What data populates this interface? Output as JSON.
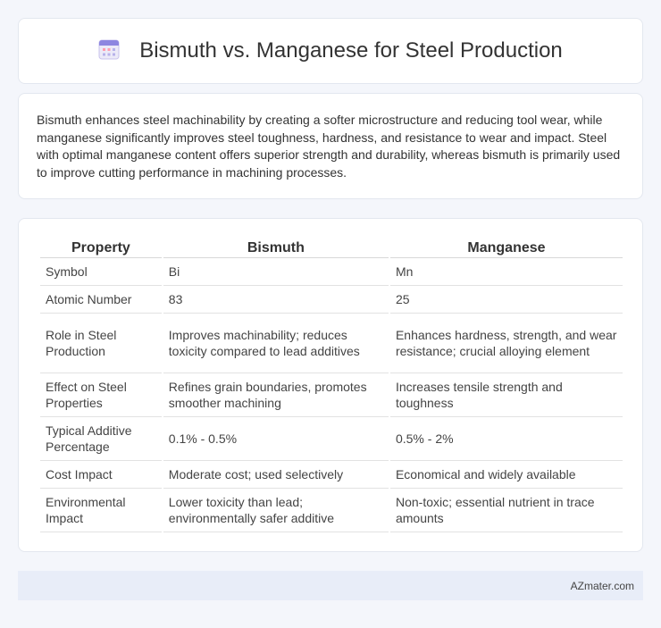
{
  "header": {
    "icon": "calendar-grid-icon",
    "title": "Bismuth vs. Manganese for Steel Production"
  },
  "summary": {
    "text": "Bismuth enhances steel machinability by creating a softer microstructure and reducing tool wear, while manganese significantly improves steel toughness, hardness, and resistance to wear and impact. Steel with optimal manganese content offers superior strength and durability, whereas bismuth is primarily used to improve cutting performance in machining processes."
  },
  "table": {
    "headers": [
      "Property",
      "Bismuth",
      "Manganese"
    ],
    "rows": [
      [
        "Symbol",
        "Bi",
        "Mn"
      ],
      [
        "Atomic Number",
        "83",
        "25"
      ],
      [
        "Role in Steel Production",
        "Improves machinability; reduces toxicity compared to lead additives",
        "Enhances hardness, strength, and wear resistance; crucial alloying element"
      ],
      [
        "Effect on Steel Properties",
        "Refines grain boundaries, promotes smoother machining",
        "Increases tensile strength and toughness"
      ],
      [
        "Typical Additive Percentage",
        "0.1% - 0.5%",
        "0.5% - 2%"
      ],
      [
        "Cost Impact",
        "Moderate cost; used selectively",
        "Economical and widely available"
      ],
      [
        "Environmental Impact",
        "Lower toxicity than lead; environmentally safer additive",
        "Non-toxic; essential nutrient in trace amounts"
      ]
    ]
  },
  "footer": {
    "site": "AZmater.com"
  }
}
